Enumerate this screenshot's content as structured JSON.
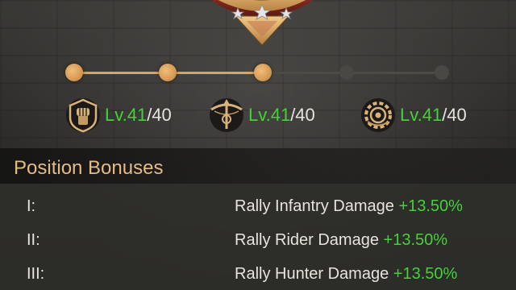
{
  "progress": {
    "total_nodes": 5,
    "reached_nodes": 3
  },
  "troops": [
    {
      "name": "infantry",
      "icon": "fist-shield-icon",
      "current": "Lv.41",
      "max": "/40"
    },
    {
      "name": "rider",
      "icon": "crossbow-icon",
      "current": "Lv.41",
      "max": "/40"
    },
    {
      "name": "hunter",
      "icon": "gear-wheel-icon",
      "current": "Lv.41",
      "max": "/40"
    }
  ],
  "bonuses": {
    "title": "Position Bonuses",
    "rows": [
      {
        "num": "I:",
        "label": "Rally Infantry Damage",
        "value": "+13.50%"
      },
      {
        "num": "II:",
        "label": "Rally Rider Damage",
        "value": "+13.50%"
      },
      {
        "num": "III:",
        "label": "Rally Hunter Damage",
        "value": "+13.50%"
      }
    ]
  },
  "colors": {
    "accent": "#d9a461",
    "positive": "#44d13a",
    "title": "#e3bb86"
  }
}
